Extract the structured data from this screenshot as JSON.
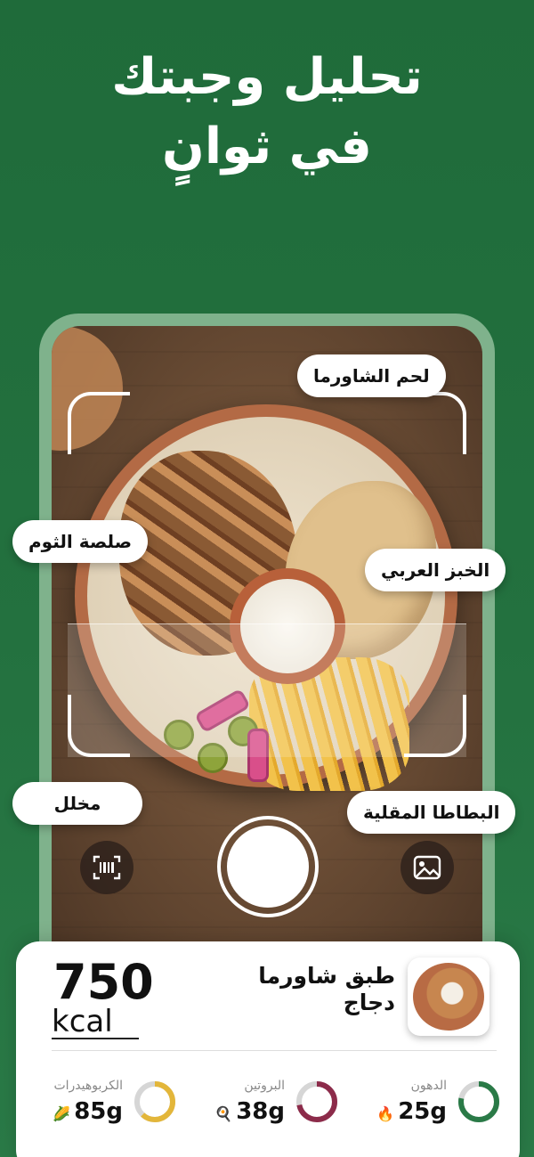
{
  "headline": {
    "line1": "تحليل وجبتك",
    "line2": "في ثوانٍ"
  },
  "tags": {
    "meat": "لحم الشاورما",
    "garlic": "صلصة الثوم",
    "bread": "الخبز العربي",
    "pickles": "مخلل",
    "fries": "البطاطا المقلية"
  },
  "camera": {
    "barcode_icon": "barcode-icon",
    "gallery_icon": "gallery-icon"
  },
  "result": {
    "calories": "750",
    "unit": "kcal",
    "dish_line1": "طبق شاورما",
    "dish_line2": "دجاج"
  },
  "macros": [
    {
      "label": "الكربوهيدرات",
      "value": "85g",
      "emoji": "🌽",
      "percent": 0.62,
      "color": "#e3b63a"
    },
    {
      "label": "البروتين",
      "value": "38g",
      "emoji": "🍳",
      "percent": 0.72,
      "color": "#8c2b4a"
    },
    {
      "label": "الدهون",
      "value": "25g",
      "emoji": "🔥",
      "percent": 0.78,
      "color": "#2a7a47"
    }
  ],
  "colors": {
    "brand_green": "#23713f",
    "phone_frame": "#7fb28c"
  }
}
